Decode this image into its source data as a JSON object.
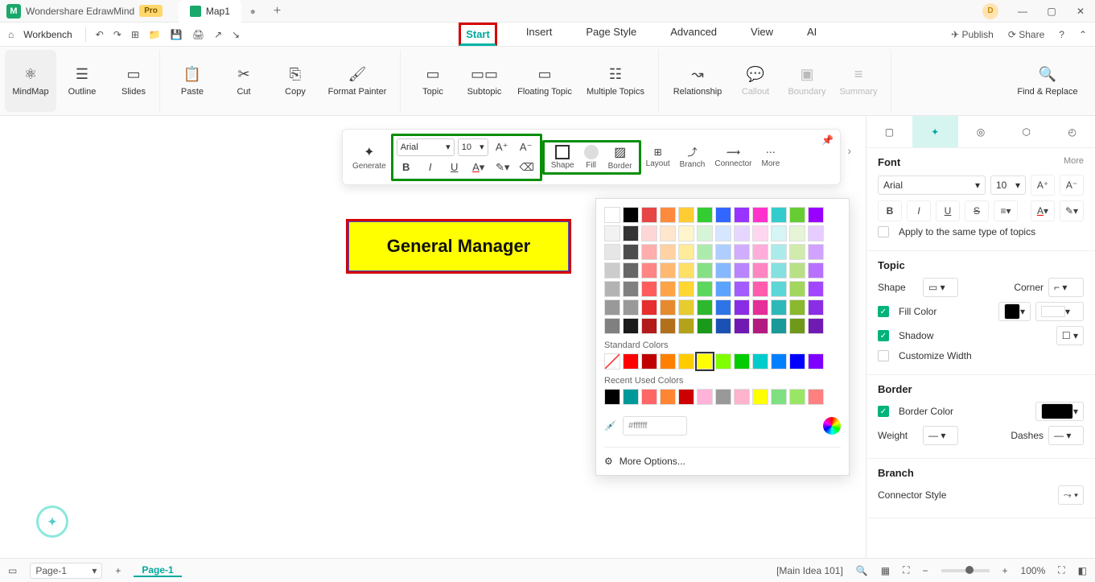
{
  "app": {
    "name": "Wondershare EdrawMind",
    "badge": "Pro",
    "tab": "Map1",
    "user_initial": "D"
  },
  "qab": {
    "workbench": "Workbench",
    "publish": "Publish",
    "share": "Share"
  },
  "menu": {
    "start": "Start",
    "insert": "Insert",
    "pageStyle": "Page Style",
    "advanced": "Advanced",
    "view": "View",
    "ai": "AI"
  },
  "ribbon": {
    "mindmap": "MindMap",
    "outline": "Outline",
    "slides": "Slides",
    "paste": "Paste",
    "cut": "Cut",
    "copy": "Copy",
    "formatPainter": "Format Painter",
    "topic": "Topic",
    "subtopic": "Subtopic",
    "floatingTopic": "Floating Topic",
    "multipleTopics": "Multiple Topics",
    "relationship": "Relationship",
    "callout": "Callout",
    "boundary": "Boundary",
    "summary": "Summary",
    "findReplace": "Find & Replace"
  },
  "float": {
    "generate": "Generate",
    "font": "Arial",
    "size": "10",
    "shape": "Shape",
    "fill": "Fill",
    "border": "Border",
    "layout": "Layout",
    "branch": "Branch",
    "connector": "Connector",
    "more": "More"
  },
  "node": {
    "text": "General Manager"
  },
  "colors": {
    "standard_label": "Standard Colors",
    "recent_label": "Recent Used Colors",
    "hex": "#ffffff",
    "more_options": "More Options...",
    "main": [
      "#ffffff",
      "#000000",
      "#e64545",
      "#ff8a3d",
      "#ffcc33",
      "#33cc33",
      "#3366ff",
      "#9933ff",
      "#ff33cc",
      "#33cccc",
      "#66cc33",
      "#9900ff",
      "#f2f2f2",
      "#333333",
      "#ffd6d6",
      "#ffe6cc",
      "#fff5cc",
      "#d6f5d6",
      "#d6e6ff",
      "#e6d6ff",
      "#ffd6f0",
      "#d6f5f5",
      "#e6f5d6",
      "#e6ccff",
      "#e6e6e6",
      "#4d4d4d",
      "#ffadad",
      "#ffd1a3",
      "#ffeb99",
      "#adebad",
      "#adceff",
      "#d1adff",
      "#ffadda",
      "#adebeb",
      "#d1ebad",
      "#d1a3ff",
      "#cccccc",
      "#666666",
      "#ff8585",
      "#ffb870",
      "#ffe066",
      "#85e085",
      "#85b8ff",
      "#b885ff",
      "#ff85c2",
      "#85e0e0",
      "#b8e085",
      "#b870ff",
      "#b3b3b3",
      "#808080",
      "#ff5c5c",
      "#ffa347",
      "#ffd633",
      "#5cd65c",
      "#5ca3ff",
      "#a35cff",
      "#ff5cad",
      "#5cd6d6",
      "#a3d65c",
      "#a347ff",
      "#999999",
      "#999999",
      "#e62e2e",
      "#e68a2e",
      "#e6cc2e",
      "#2eb82e",
      "#2e74e6",
      "#8a2ee6",
      "#e62e99",
      "#2eb8b8",
      "#8ab82e",
      "#8a2ee6",
      "#808080",
      "#1a1a1a",
      "#b31a1a",
      "#b3701a",
      "#b3a31a",
      "#1a991a",
      "#1a52b3",
      "#701ab3",
      "#b31a80",
      "#1a9999",
      "#70991a",
      "#701ab3"
    ],
    "standard": [
      "#ffffff",
      "#ff0000",
      "#c00000",
      "#ff8000",
      "#ffcc00",
      "#ffff00",
      "#80ff00",
      "#00cc00",
      "#00cccc",
      "#0080ff",
      "#0000ff",
      "#8000ff"
    ],
    "recent": [
      "#000000",
      "#009999",
      "#ff6666",
      "#ff8533",
      "#cc0000",
      "#ffb3d9",
      "#999999",
      "#ffb3cc",
      "#ffff00",
      "#80e080",
      "#99e666",
      "#ff8080"
    ]
  },
  "side": {
    "font": "Font",
    "more": "More",
    "fontName": "Arial",
    "fontSize": "10",
    "apply": "Apply to the same type of topics",
    "topic": "Topic",
    "shape": "Shape",
    "corner": "Corner",
    "fillColor": "Fill Color",
    "shadow": "Shadow",
    "customWidth": "Customize Width",
    "border": "Border",
    "borderColor": "Border Color",
    "weight": "Weight",
    "dashes": "Dashes",
    "branch": "Branch",
    "connStyle": "Connector Style"
  },
  "status": {
    "page": "Page-1",
    "pageTab": "Page-1",
    "main": "[Main Idea 101]",
    "zoom": "100%"
  }
}
